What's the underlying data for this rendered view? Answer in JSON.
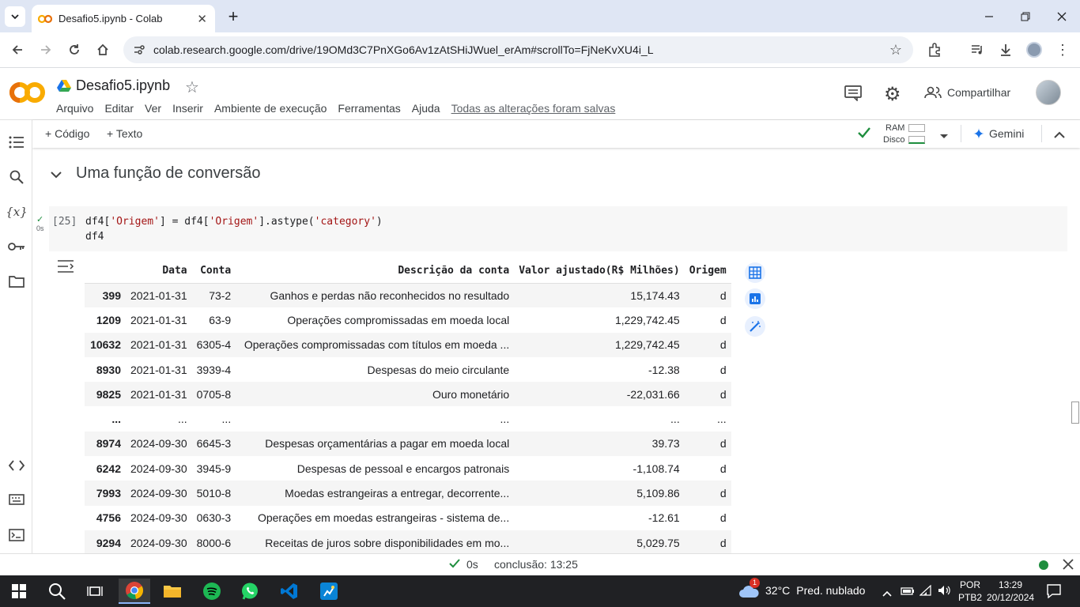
{
  "browser": {
    "tab_title": "Desafio5.ipynb - Colab",
    "url": "colab.research.google.com/drive/19OMd3C7PnXGo6Av1zAtSHiJWuel_erAm#scrollTo=FjNeKvXU4i_L"
  },
  "colab": {
    "logo_text": "CO",
    "notebook_title": "Desafio5.ipynb",
    "menu": [
      "Arquivo",
      "Editar",
      "Ver",
      "Inserir",
      "Ambiente de execução",
      "Ferramentas",
      "Ajuda"
    ],
    "saved_status": "Todas as alterações foram salvas",
    "share_label": "Compartilhar",
    "toolbar": {
      "add_code": "Código",
      "add_text": "Texto",
      "ram": "RAM",
      "disk": "Disco",
      "gemini": "Gemini"
    }
  },
  "section": {
    "title": "Uma função de conversão"
  },
  "cell": {
    "exec_count": "[25]",
    "exec_time": "0s",
    "line1_a": "df4[",
    "line1_b": "'Origem'",
    "line1_c": "] = df4[",
    "line1_d": "'Origem'",
    "line1_e": "].astype(",
    "line1_f": "'category'",
    "line1_g": ")",
    "line2": "df4"
  },
  "dataframe": {
    "columns": [
      "",
      "Data",
      "Conta",
      "Descrição da conta",
      "Valor ajustado(R$ Milhões)",
      "Origem"
    ],
    "rows": [
      [
        "399",
        "2021-01-31",
        "73-2",
        "Ganhos e perdas não reconhecidos no resultado",
        "15,174.43",
        "d"
      ],
      [
        "1209",
        "2021-01-31",
        "63-9",
        "Operações compromissadas em moeda local",
        "1,229,742.45",
        "d"
      ],
      [
        "10632",
        "2021-01-31",
        "6305-4",
        "Operações compromissadas com títulos em moeda ...",
        "1,229,742.45",
        "d"
      ],
      [
        "8930",
        "2021-01-31",
        "3939-4",
        "Despesas do meio circulante",
        "-12.38",
        "d"
      ],
      [
        "9825",
        "2021-01-31",
        "0705-8",
        "Ouro monetário",
        "-22,031.66",
        "d"
      ],
      [
        "...",
        "...",
        "...",
        "...",
        "...",
        "..."
      ],
      [
        "8974",
        "2024-09-30",
        "6645-3",
        "Despesas orçamentárias a pagar em moeda local",
        "39.73",
        "d"
      ],
      [
        "6242",
        "2024-09-30",
        "3945-9",
        "Despesas de pessoal e encargos patronais",
        "-1,108.74",
        "d"
      ],
      [
        "7993",
        "2024-09-30",
        "5010-8",
        "Moedas estrangeiras a entregar, decorrente...",
        "5,109.86",
        "d"
      ],
      [
        "4756",
        "2024-09-30",
        "0630-3",
        "Operações em moedas estrangeiras - sistema de...",
        "-12.61",
        "d"
      ],
      [
        "9294",
        "2024-09-30",
        "8000-6",
        "Receitas de juros sobre disponibilidades em mo...",
        "5,029.75",
        "d"
      ]
    ]
  },
  "statusbar": {
    "time": "0s",
    "completion": "conclusão: 13:25"
  },
  "taskbar": {
    "weather_temp": "32°C",
    "weather_desc": "Pred. nublado",
    "weather_badge": "1",
    "lang": "POR",
    "layout": "PTB2",
    "clock": "13:29",
    "date": "20/12/2024"
  },
  "colors": {
    "accent": "#1a73e8",
    "green": "#1e8e3e",
    "colab_orange": "#f9ab00"
  }
}
